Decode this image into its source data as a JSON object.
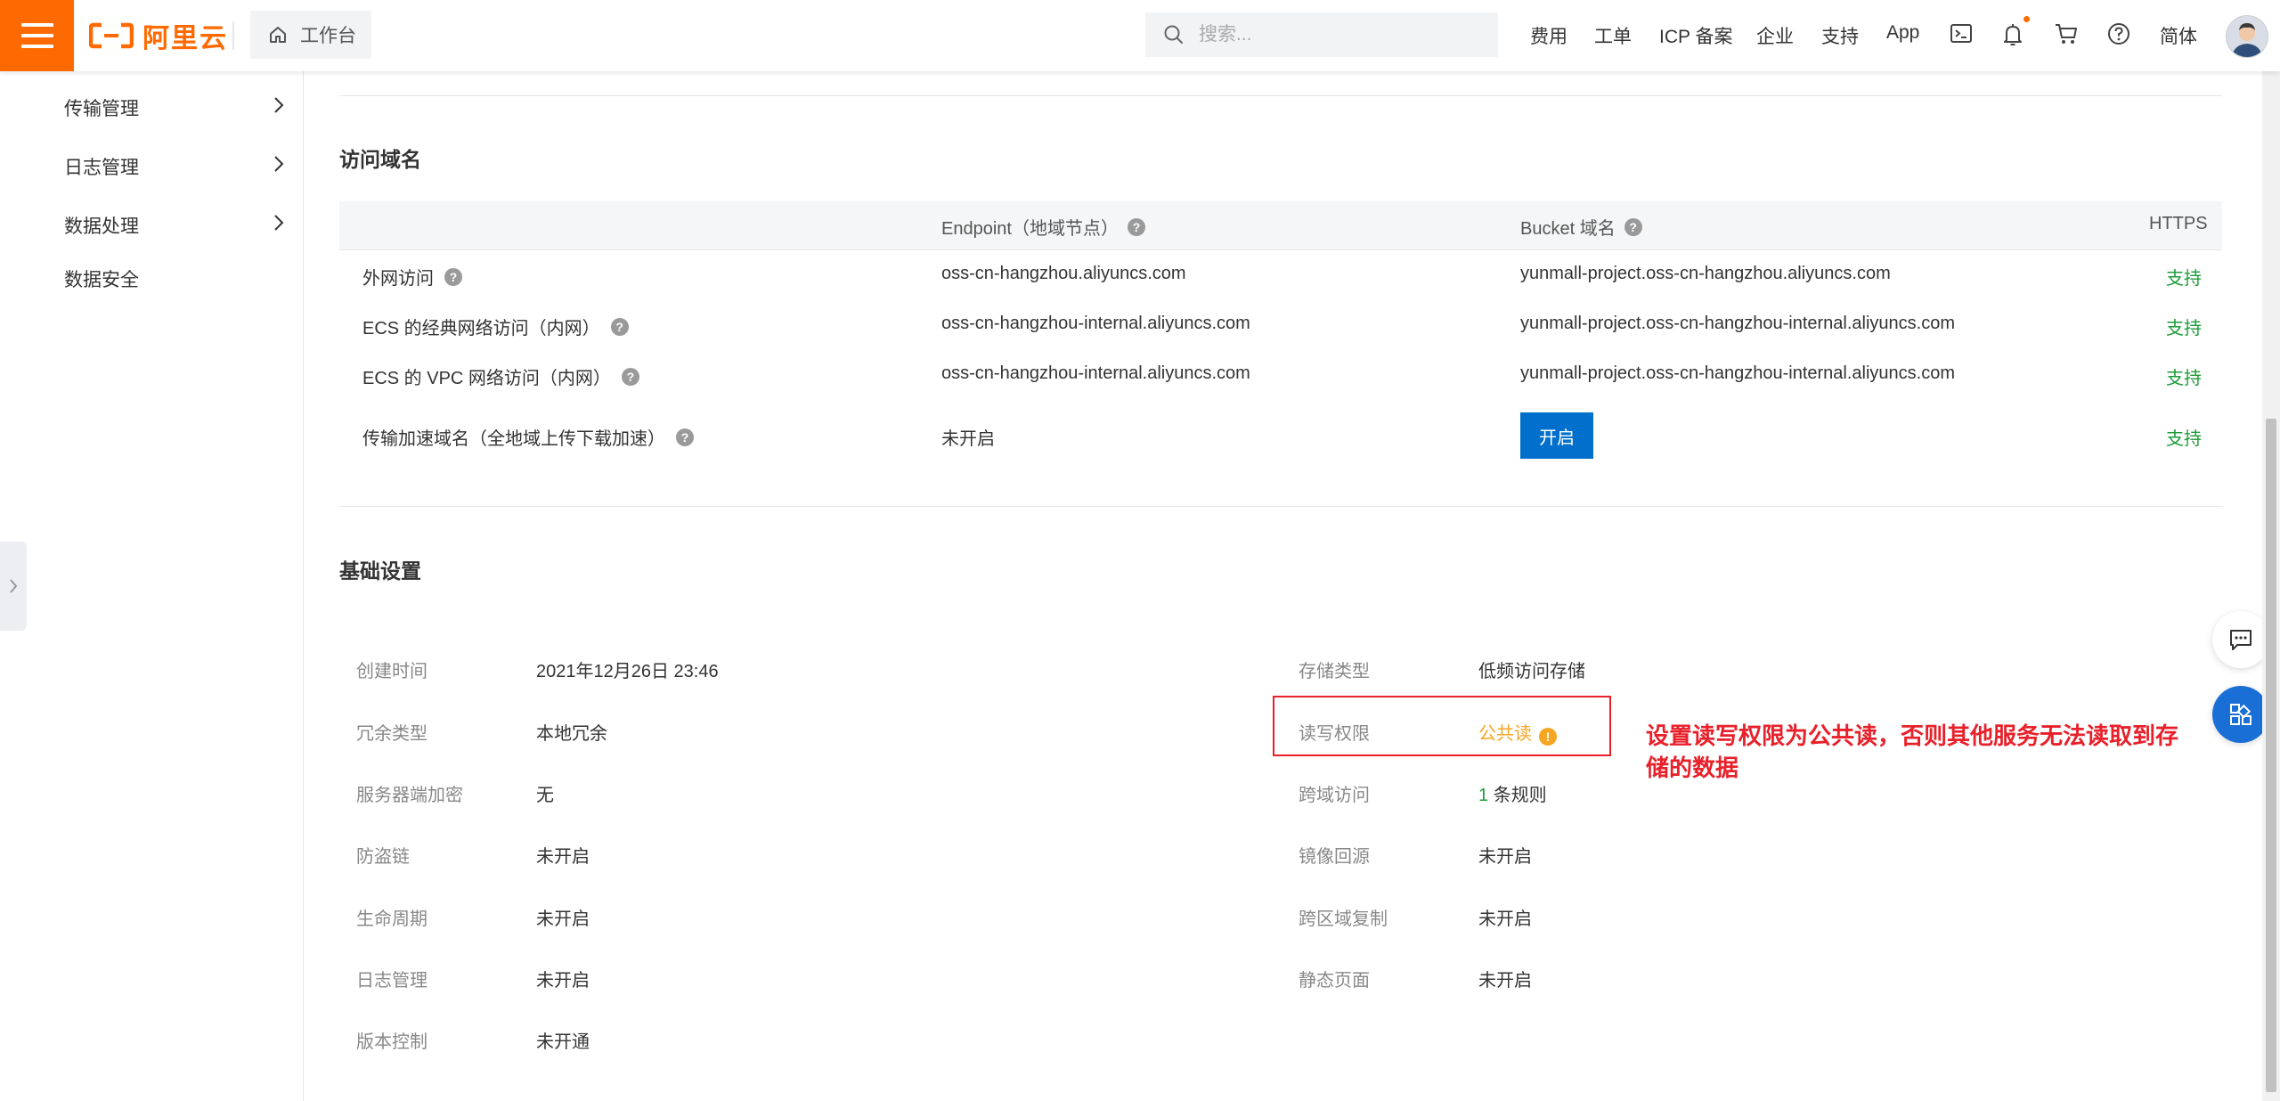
{
  "topbar": {
    "logo_text": "阿里云",
    "workbench_label": "工作台",
    "search_placeholder": "搜索...",
    "nav": [
      "费用",
      "工单",
      "ICP 备案",
      "企业",
      "支持",
      "App"
    ],
    "language": "简体",
    "brand_color": "#ff6a00"
  },
  "sidebar": {
    "items": [
      {
        "label": "传输管理",
        "has_children": true
      },
      {
        "label": "日志管理",
        "has_children": true
      },
      {
        "label": "数据处理",
        "has_children": true
      },
      {
        "label": "数据安全",
        "has_children": false
      }
    ]
  },
  "access_domains": {
    "title": "访问域名",
    "columns": [
      "Endpoint（地域节点）",
      "Bucket 域名",
      "HTTPS"
    ],
    "rows": [
      {
        "label": "外网访问",
        "endpoint": "oss-cn-hangzhou.aliyuncs.com",
        "bucket": "yunmall-project.oss-cn-hangzhou.aliyuncs.com",
        "https": "支持"
      },
      {
        "label": "ECS 的经典网络访问（内网）",
        "endpoint": "oss-cn-hangzhou-internal.aliyuncs.com",
        "bucket": "yunmall-project.oss-cn-hangzhou-internal.aliyuncs.com",
        "https": "支持"
      },
      {
        "label": "ECS 的 VPC 网络访问（内网）",
        "endpoint": "oss-cn-hangzhou-internal.aliyuncs.com",
        "bucket": "yunmall-project.oss-cn-hangzhou-internal.aliyuncs.com",
        "https": "支持"
      },
      {
        "label": "传输加速域名（全地域上传下载加速）",
        "endpoint": "未开启",
        "bucket_button": "开启",
        "https": "支持"
      }
    ]
  },
  "basic_settings": {
    "title": "基础设置",
    "left": [
      {
        "label": "创建时间",
        "value": "2021年12月26日 23:46"
      },
      {
        "label": "冗余类型",
        "value": "本地冗余"
      },
      {
        "label": "服务器端加密",
        "value": "无"
      },
      {
        "label": "防盗链",
        "value": "未开启"
      },
      {
        "label": "生命周期",
        "value": "未开启"
      },
      {
        "label": "日志管理",
        "value": "未开启"
      },
      {
        "label": "版本控制",
        "value": "未开通"
      }
    ],
    "right": [
      {
        "label": "存储类型",
        "value": "低频访问存储"
      },
      {
        "label": "读写权限",
        "value": "公共读"
      },
      {
        "label": "跨域访问",
        "count": "1",
        "value": "条规则"
      },
      {
        "label": "镜像回源",
        "value": "未开启"
      },
      {
        "label": "跨区域复制",
        "value": "未开启"
      },
      {
        "label": "静态页面",
        "value": "未开启"
      }
    ]
  },
  "annotation": {
    "text": "设置读写权限为公共读，否则其他服务无法读取到存储的数据",
    "color": "#e8202a"
  }
}
